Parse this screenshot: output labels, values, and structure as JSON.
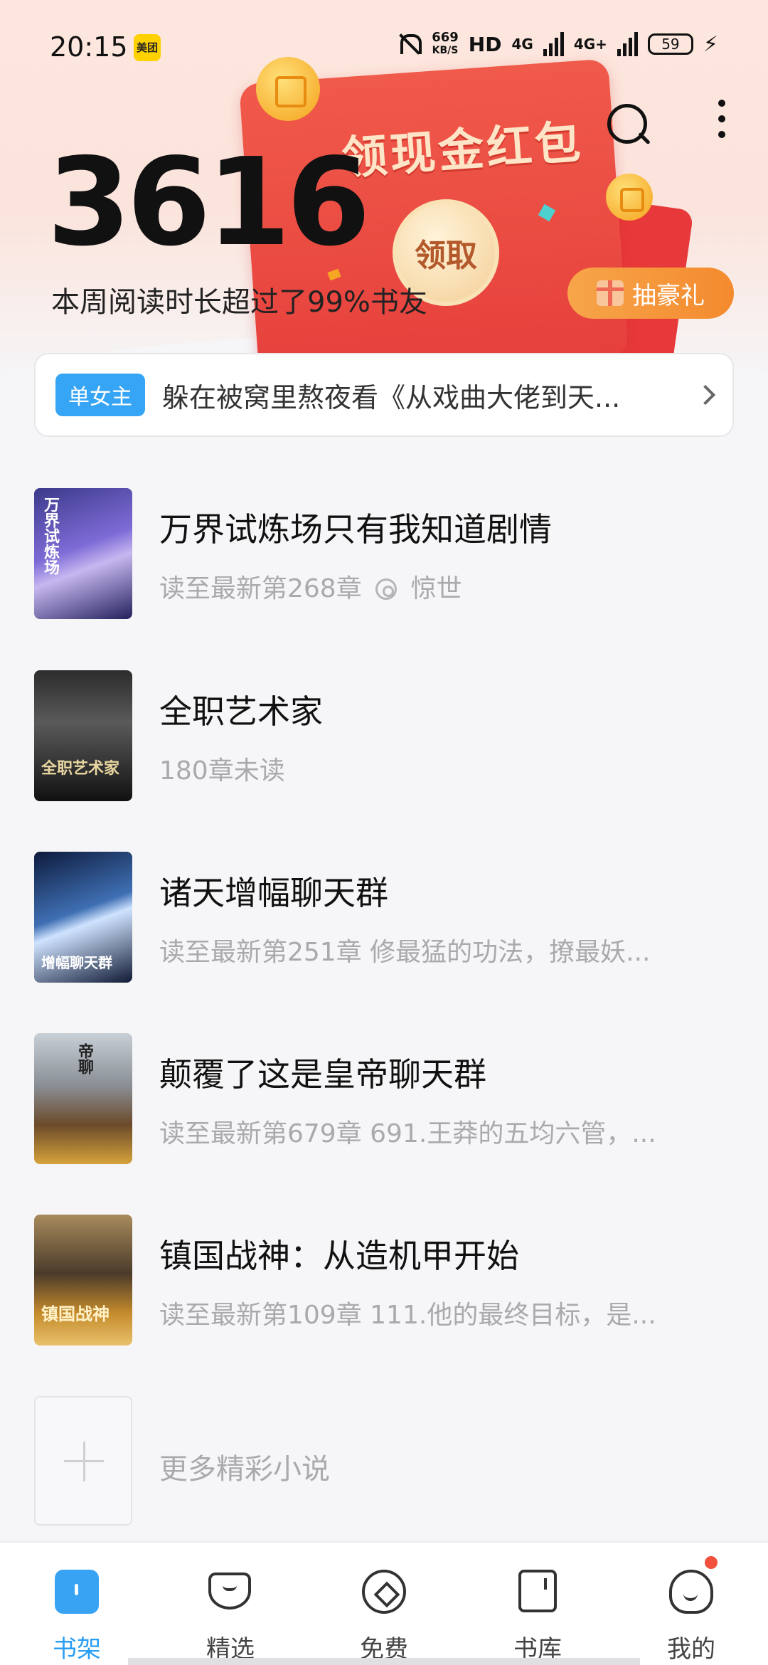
{
  "status_bar": {
    "time": "20:15",
    "app_badge": "美团",
    "speed_value": "669",
    "speed_unit": "KB/S",
    "hd_label": "HD",
    "net1": "4G",
    "net2": "4G+",
    "battery": "59",
    "icons": [
      "mute-icon",
      "signal-icon",
      "battery-icon",
      "charging-icon"
    ]
  },
  "header": {
    "search_icon": "search-icon",
    "more_icon": "more-vertical-icon"
  },
  "promo_packet": {
    "title": "领现金红包",
    "claim_label": "领取"
  },
  "stats": {
    "reading_minutes": "3616",
    "description": "本周阅读时长超过了99%书友"
  },
  "gift": {
    "label": "抽豪礼"
  },
  "banner": {
    "tag": "单女主",
    "text": "躲在被窝里熬夜看《从戏曲大佬到天..."
  },
  "books": [
    {
      "title": "万界试炼场只有我知道剧情",
      "progress": "读至最新第268章",
      "extra": "惊世",
      "cover_text": "万界试炼场"
    },
    {
      "title": "全职艺术家",
      "progress": "180章未读",
      "extra": "",
      "cover_text": "全职艺术家"
    },
    {
      "title": "诸天增幅聊天群",
      "progress": "读至最新第251章 修最猛的功法，撩最妖...",
      "extra": "",
      "cover_text": "增幅聊天群"
    },
    {
      "title": "颠覆了这是皇帝聊天群",
      "progress": "读至最新第679章 691.王莽的五均六管，...",
      "extra": "",
      "cover_text": "帝聊"
    },
    {
      "title": "镇国战神：从造机甲开始",
      "progress": "读至最新第109章 111.他的最终目标，是...",
      "extra": "",
      "cover_text": "镇国战神"
    }
  ],
  "more_books": "更多精彩小说",
  "bottom_nav": [
    {
      "label": "书架",
      "icon": "bookshelf-icon",
      "active": true
    },
    {
      "label": "精选",
      "icon": "diamond-icon",
      "active": false
    },
    {
      "label": "免费",
      "icon": "free-icon",
      "active": false
    },
    {
      "label": "书库",
      "icon": "library-icon",
      "active": false
    },
    {
      "label": "我的",
      "icon": "profile-icon",
      "active": false
    }
  ],
  "colors": {
    "accent": "#2a9df4",
    "packet_red": "#e6403c",
    "gift_orange": "#f48a2e",
    "tag_blue": "#37a5f5"
  }
}
